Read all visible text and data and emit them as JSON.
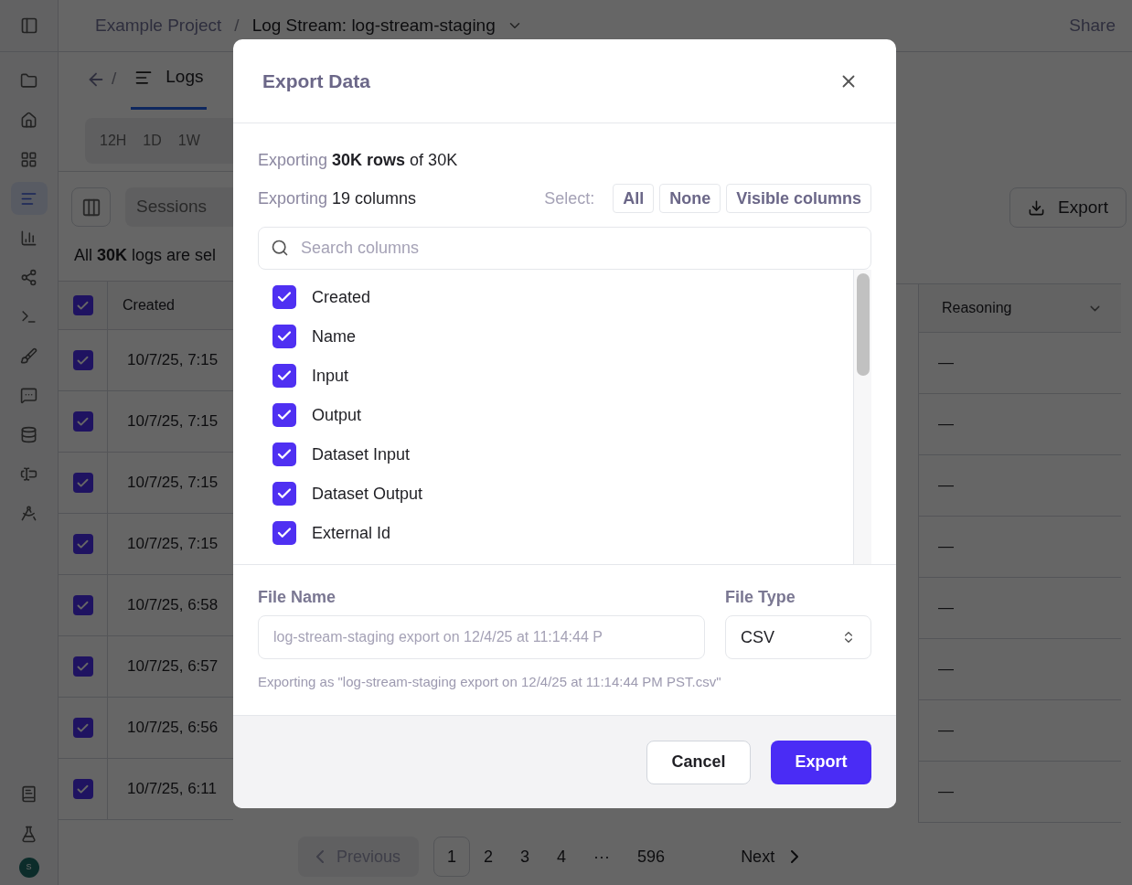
{
  "sidebar": {
    "items": [
      {
        "selected": false
      },
      {
        "selected": false
      },
      {
        "selected": false
      },
      {
        "selected": false
      },
      {
        "selected": true
      },
      {
        "selected": false
      },
      {
        "selected": false
      },
      {
        "selected": false
      },
      {
        "selected": false
      },
      {
        "selected": false
      },
      {
        "selected": false
      },
      {
        "selected": false
      },
      {
        "selected": false
      }
    ],
    "bottom_items": [
      {
        "selected": false
      },
      {
        "selected": false
      }
    ],
    "avatar": "S"
  },
  "breadcrumb": {
    "project": "Example Project",
    "separator": "/",
    "current": "Log Stream: log-stream-staging"
  },
  "share": "Share",
  "tabs": [
    {
      "label": "Logs",
      "selected": true
    }
  ],
  "back_separator": "/",
  "time_ranges": [
    {
      "label": "12H",
      "selected": false
    },
    {
      "label": "1D",
      "selected": false
    },
    {
      "label": "1W",
      "selected": false
    }
  ],
  "toolbar": {
    "sessions": "Sessions",
    "export": "Export"
  },
  "selection_note": "All **30K** logs are sel",
  "table": {
    "header_checked": true,
    "columns": [
      {
        "label": "Created"
      },
      {
        "label": "Reasoning"
      }
    ],
    "rows": [
      {
        "checked": true,
        "created": "10/7/25, 7:15",
        "reasoning": "—"
      },
      {
        "checked": true,
        "created": "10/7/25, 7:15",
        "reasoning": "—"
      },
      {
        "checked": true,
        "created": "10/7/25, 7:15",
        "reasoning": "—"
      },
      {
        "checked": true,
        "created": "10/7/25, 7:15",
        "reasoning": "—"
      },
      {
        "checked": true,
        "created": "10/7/25, 6:58",
        "reasoning": "—"
      },
      {
        "checked": true,
        "created": "10/7/25, 6:57",
        "reasoning": "—"
      },
      {
        "checked": true,
        "created": "10/7/25, 6:56",
        "reasoning": "—"
      },
      {
        "checked": true,
        "created": "10/7/25, 6:11",
        "reasoning": "—"
      }
    ]
  },
  "pagination": {
    "previous": "Previous",
    "pages": [
      {
        "label": "1",
        "selected": true
      },
      {
        "label": "2",
        "selected": false
      },
      {
        "label": "3",
        "selected": false
      },
      {
        "label": "4",
        "selected": false
      },
      {
        "label": "···",
        "selected": false
      },
      {
        "label": "596",
        "selected": false
      }
    ],
    "next": "Next"
  },
  "dialog": {
    "title": "Export Data",
    "rows_summary": {
      "prefix": "Exporting",
      "detail": "**30K rows** of 30K"
    },
    "columns_summary": {
      "prefix": "Exporting",
      "detail": "19 columns"
    },
    "select_label": "Select:",
    "select_buttons": [
      "All",
      "None",
      "Visible columns"
    ],
    "search": {
      "placeholder": "Search columns"
    },
    "columns": [
      {
        "label": "Created",
        "checked": true
      },
      {
        "label": "Name",
        "checked": true
      },
      {
        "label": "Input",
        "checked": true
      },
      {
        "label": "Output",
        "checked": true
      },
      {
        "label": "Dataset Input",
        "checked": true
      },
      {
        "label": "Dataset Output",
        "checked": true
      },
      {
        "label": "External Id",
        "checked": true
      }
    ],
    "file_name": {
      "label": "File Name",
      "placeholder": "log-stream-staging export on 12/4/25 at 11:14:44 P"
    },
    "file_type": {
      "label": "File Type",
      "value": "CSV"
    },
    "hint": "Exporting as \"log-stream-staging export on 12/4/25 at 11:14:44 PM PST.csv\"",
    "cancel": "Cancel",
    "confirm": "Export"
  }
}
